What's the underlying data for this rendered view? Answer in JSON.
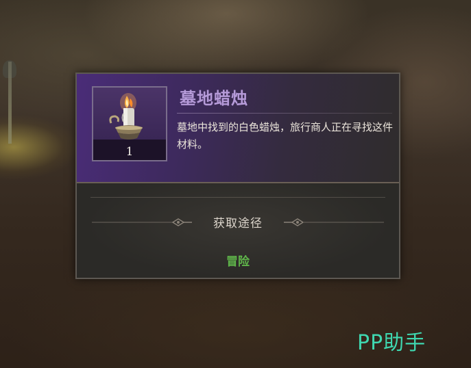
{
  "item": {
    "name": "墓地蜡烛",
    "count": "1",
    "description": "墓地中找到的白色蜡烛，旅行商人正在寻找这件材料。",
    "icon": "candle-icon",
    "name_color": "#b59ad8"
  },
  "source": {
    "title": "获取途径",
    "entries": [
      "冒险"
    ],
    "entry_color": "#5fb54a"
  },
  "watermark": {
    "text": "PP助手",
    "color": "#3fd7b0"
  }
}
